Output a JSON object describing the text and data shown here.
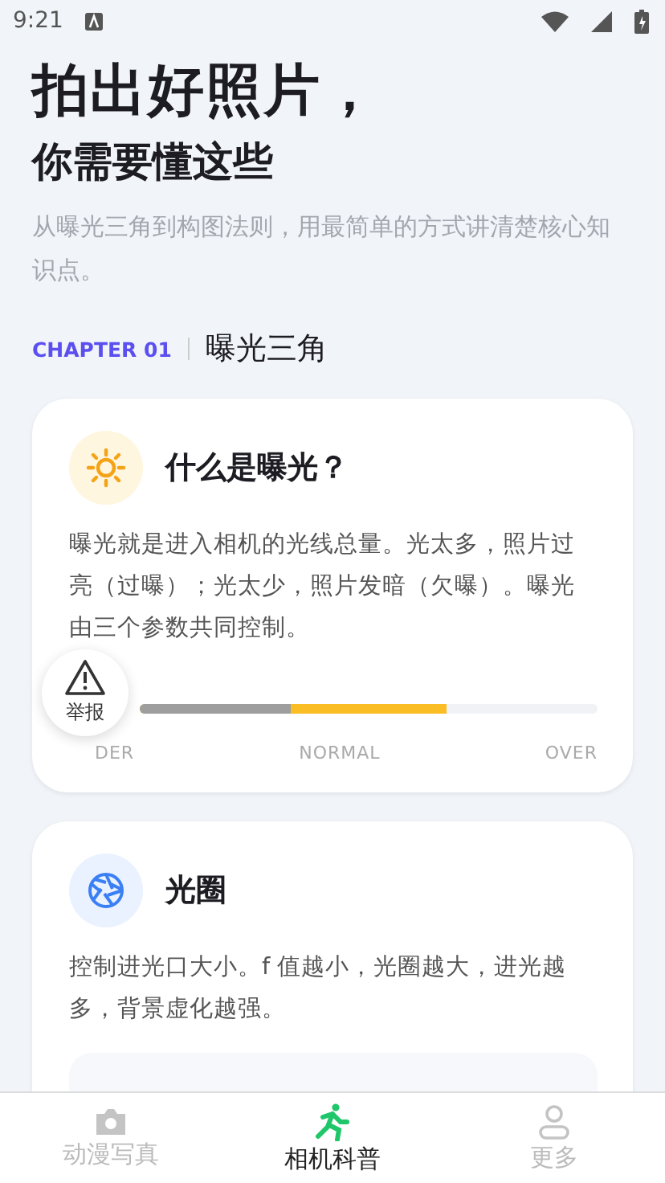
{
  "status_bar": {
    "time": "9:21"
  },
  "hero": {
    "title": "拍出好照片，",
    "subtitle": "你需要懂这些",
    "description": "从曝光三角到构图法则，用最简单的方式讲清楚核心知识点。"
  },
  "chapter": {
    "label": "CHAPTER 01",
    "title": "曝光三角"
  },
  "cards": [
    {
      "kind": "exposure",
      "title": "什么是曝光？",
      "body": "曝光就是进入相机的光线总量。光太多，照片过亮（过曝）；光太少，照片发暗（欠曝）。曝光由三个参数共同控制。",
      "meter": {
        "segments": [
          {
            "kind": "under",
            "level": 0.33
          },
          {
            "kind": "normal",
            "level": 0.67
          }
        ],
        "labels": [
          "DER",
          "NORMAL",
          "OVER"
        ]
      }
    },
    {
      "kind": "aperture",
      "title": "光圈",
      "body": "控制进光口大小。f 值越小，光圈越大，进光越多，背景虚化越强。"
    }
  ],
  "report_button": {
    "label": "举报"
  },
  "tabs": [
    {
      "kind": "camera",
      "label": "动漫写真",
      "selected": false
    },
    {
      "kind": "runner",
      "label": "相机科普",
      "selected": true
    },
    {
      "kind": "person",
      "label": "更多",
      "selected": false
    }
  ]
}
